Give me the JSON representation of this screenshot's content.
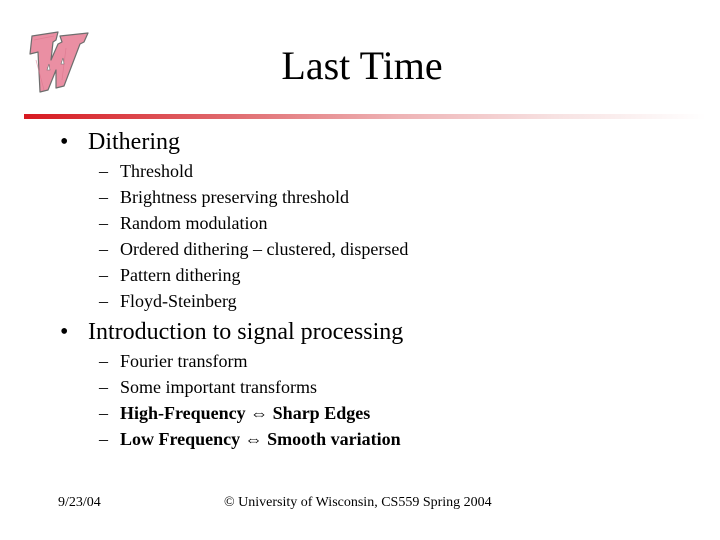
{
  "slide": {
    "title": "Last Time",
    "logo": "university-of-wisconsin-w-logo",
    "accent_color": "#d71920"
  },
  "bullets": [
    {
      "marker": "•",
      "text": "Dithering",
      "sub": [
        {
          "marker": "–",
          "text": "Threshold",
          "bold": false
        },
        {
          "marker": "–",
          "text": "Brightness preserving threshold",
          "bold": false
        },
        {
          "marker": "–",
          "text": "Random modulation",
          "bold": false
        },
        {
          "marker": "–",
          "text": "Ordered dithering – clustered, dispersed",
          "bold": false
        },
        {
          "marker": "–",
          "text": "Pattern dithering",
          "bold": false
        },
        {
          "marker": "–",
          "text": "Floyd-Steinberg",
          "bold": false
        }
      ]
    },
    {
      "marker": "•",
      "text": "Introduction to signal processing",
      "sub": [
        {
          "marker": "–",
          "text": "Fourier transform",
          "bold": false
        },
        {
          "marker": "–",
          "text": "Some important transforms",
          "bold": false
        },
        {
          "marker": "–",
          "text": "High-Frequency ⇔ Sharp Edges",
          "bold": true
        },
        {
          "marker": "–",
          "text": "Low Frequency ⇔ Smooth variation",
          "bold": true
        }
      ]
    }
  ],
  "footer": {
    "date": "9/23/04",
    "copyright": "© University of Wisconsin, CS559 Spring 2004"
  }
}
